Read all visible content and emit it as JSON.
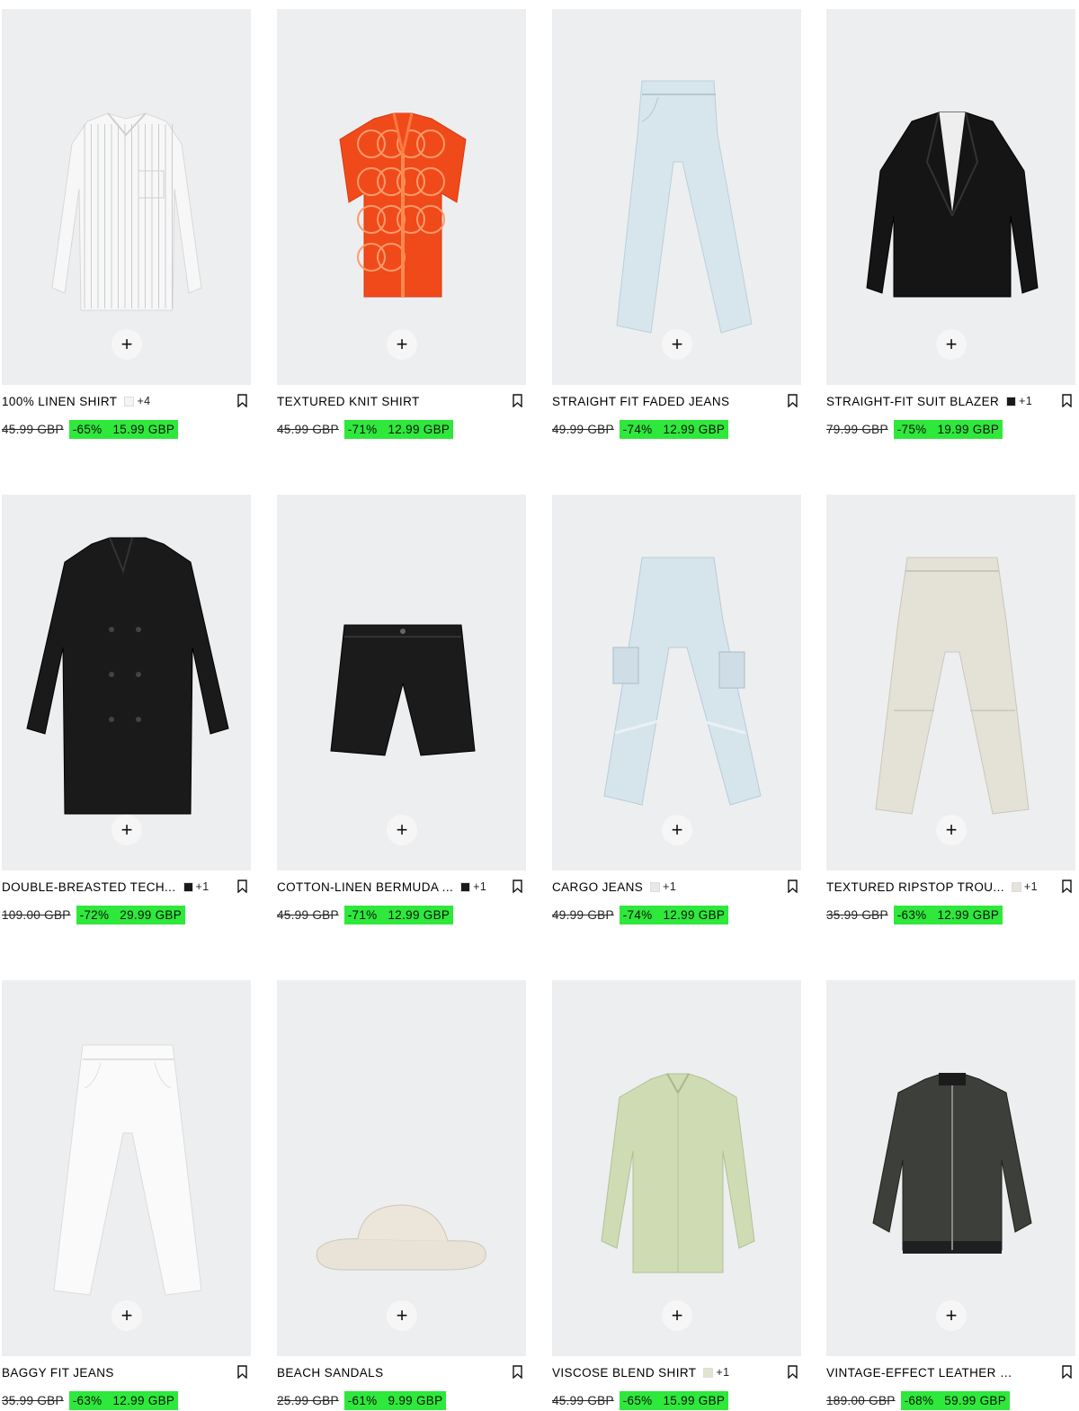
{
  "products": [
    {
      "name": "100% LINEN SHIRT",
      "swatch_color": "#f4f4f4",
      "more": "+4",
      "old_price": "45.99 GBP",
      "discount": "-65%",
      "price": "15.99 GBP",
      "icon": "linen-shirt"
    },
    {
      "name": "TEXTURED KNIT SHIRT",
      "swatch_color": "",
      "more": "",
      "old_price": "45.99 GBP",
      "discount": "-71%",
      "price": "12.99 GBP",
      "icon": "knit-shirt"
    },
    {
      "name": "STRAIGHT FIT FADED JEANS",
      "swatch_color": "",
      "more": "",
      "old_price": "49.99 GBP",
      "discount": "-74%",
      "price": "12.99 GBP",
      "icon": "faded-jeans"
    },
    {
      "name": "STRAIGHT-FIT SUIT BLAZER",
      "swatch_color": "#1a1a1a",
      "more": "+1",
      "old_price": "79.99 GBP",
      "discount": "-75%",
      "price": "19.99 GBP",
      "icon": "suit-blazer"
    },
    {
      "name": "DOUBLE-BREASTED TECH...",
      "swatch_color": "#1a1a1a",
      "more": "+1",
      "old_price": "109.00 GBP",
      "discount": "-72%",
      "price": "29.99 GBP",
      "icon": "trench-coat"
    },
    {
      "name": "COTTON-LINEN BERMUDA ...",
      "swatch_color": "#1a1a1a",
      "more": "+1",
      "old_price": "45.99 GBP",
      "discount": "-71%",
      "price": "12.99 GBP",
      "icon": "bermuda-shorts"
    },
    {
      "name": "CARGO JEANS",
      "swatch_color": "#e6e9ec",
      "more": "+1",
      "old_price": "49.99 GBP",
      "discount": "-74%",
      "price": "12.99 GBP",
      "icon": "cargo-jeans"
    },
    {
      "name": "TEXTURED RIPSTOP TROU...",
      "swatch_color": "#e6e3dc",
      "more": "+1",
      "old_price": "35.99 GBP",
      "discount": "-63%",
      "price": "12.99 GBP",
      "icon": "ripstop-trousers"
    },
    {
      "name": "BAGGY FIT JEANS",
      "swatch_color": "",
      "more": "",
      "old_price": "35.99 GBP",
      "discount": "-63%",
      "price": "12.99 GBP",
      "icon": "baggy-jeans"
    },
    {
      "name": "BEACH SANDALS",
      "swatch_color": "",
      "more": "",
      "old_price": "25.99 GBP",
      "discount": "-61%",
      "price": "9.99 GBP",
      "icon": "beach-sandal"
    },
    {
      "name": "VISCOSE BLEND SHIRT",
      "swatch_color": "#dfe5cf",
      "more": "+1",
      "old_price": "45.99 GBP",
      "discount": "-65%",
      "price": "15.99 GBP",
      "icon": "viscose-shirt"
    },
    {
      "name": "VINTAGE-EFFECT LEATHER BOM...",
      "swatch_color": "",
      "more": "",
      "old_price": "189.00 GBP",
      "discount": "-68%",
      "price": "59.99 GBP",
      "icon": "bomber-jacket"
    }
  ],
  "add_label": "+",
  "colors": {
    "sale_bg": "#2ee83b",
    "photo_bg": "#edeef0"
  }
}
